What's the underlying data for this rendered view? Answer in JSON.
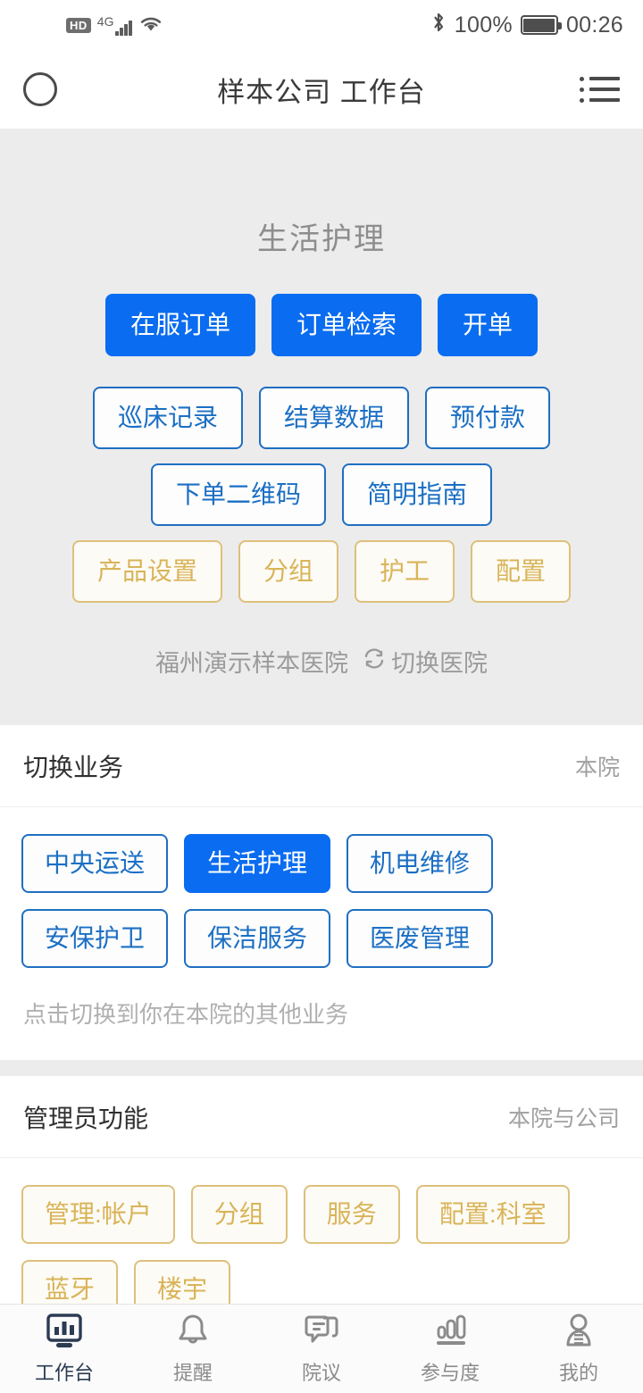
{
  "statusbar": {
    "hd_label": "HD",
    "network_label": "4G",
    "battery_percent": "100%",
    "clock": "00:26",
    "icons": [
      "hd-icon",
      "signal-bars-icon",
      "wifi-icon",
      "bluetooth-icon",
      "battery-icon"
    ]
  },
  "appbar": {
    "title": "样本公司 工作台",
    "left_icon": "circle-icon",
    "right_icon": "list-menu-icon"
  },
  "hero": {
    "title": "生活护理",
    "primary_actions": [
      {
        "label": "在服订单"
      },
      {
        "label": "订单检索"
      },
      {
        "label": "开单"
      }
    ],
    "secondary_actions_row1": [
      {
        "label": "巡床记录"
      },
      {
        "label": "结算数据"
      },
      {
        "label": "预付款"
      }
    ],
    "secondary_actions_row2": [
      {
        "label": "下单二维码"
      },
      {
        "label": "简明指南"
      }
    ],
    "admin_actions": [
      {
        "label": "产品设置"
      },
      {
        "label": "分组"
      },
      {
        "label": "护工"
      },
      {
        "label": "配置"
      }
    ],
    "hospital_name": "福州演示样本医院",
    "hospital_switch_label": "切换医院",
    "hospital_switch_icon": "swap-arrows-icon"
  },
  "switch_business": {
    "title": "切换业务",
    "scope": "本院",
    "items": [
      {
        "label": "中央运送",
        "selected": false
      },
      {
        "label": "生活护理",
        "selected": true
      },
      {
        "label": "机电维修",
        "selected": false
      },
      {
        "label": "安保护卫",
        "selected": false
      },
      {
        "label": "保洁服务",
        "selected": false
      },
      {
        "label": "医废管理",
        "selected": false
      }
    ],
    "note": "点击切换到你在本院的其他业务"
  },
  "admin_functions": {
    "title": "管理员功能",
    "scope": "本院与公司",
    "items": [
      {
        "label": "管理:帐户"
      },
      {
        "label": "分组"
      },
      {
        "label": "服务"
      },
      {
        "label": "配置:科室"
      },
      {
        "label": "蓝牙"
      },
      {
        "label": "楼宇"
      }
    ]
  },
  "tabbar": {
    "items": [
      {
        "label": "工作台",
        "icon": "dashboard-icon",
        "active": true
      },
      {
        "label": "提醒",
        "icon": "bell-icon",
        "active": false
      },
      {
        "label": "院议",
        "icon": "chat-icon",
        "active": false
      },
      {
        "label": "参与度",
        "icon": "bar-chart-icon",
        "active": false
      },
      {
        "label": "我的",
        "icon": "person-icon",
        "active": false
      }
    ]
  },
  "colors": {
    "primary_blue": "#0a6cf0",
    "outline_blue": "#1f6fc2",
    "outline_gold": "#ddc07b",
    "gold_text": "#d9b458",
    "page_bg": "#ececec",
    "tab_active": "#2b3b52"
  }
}
